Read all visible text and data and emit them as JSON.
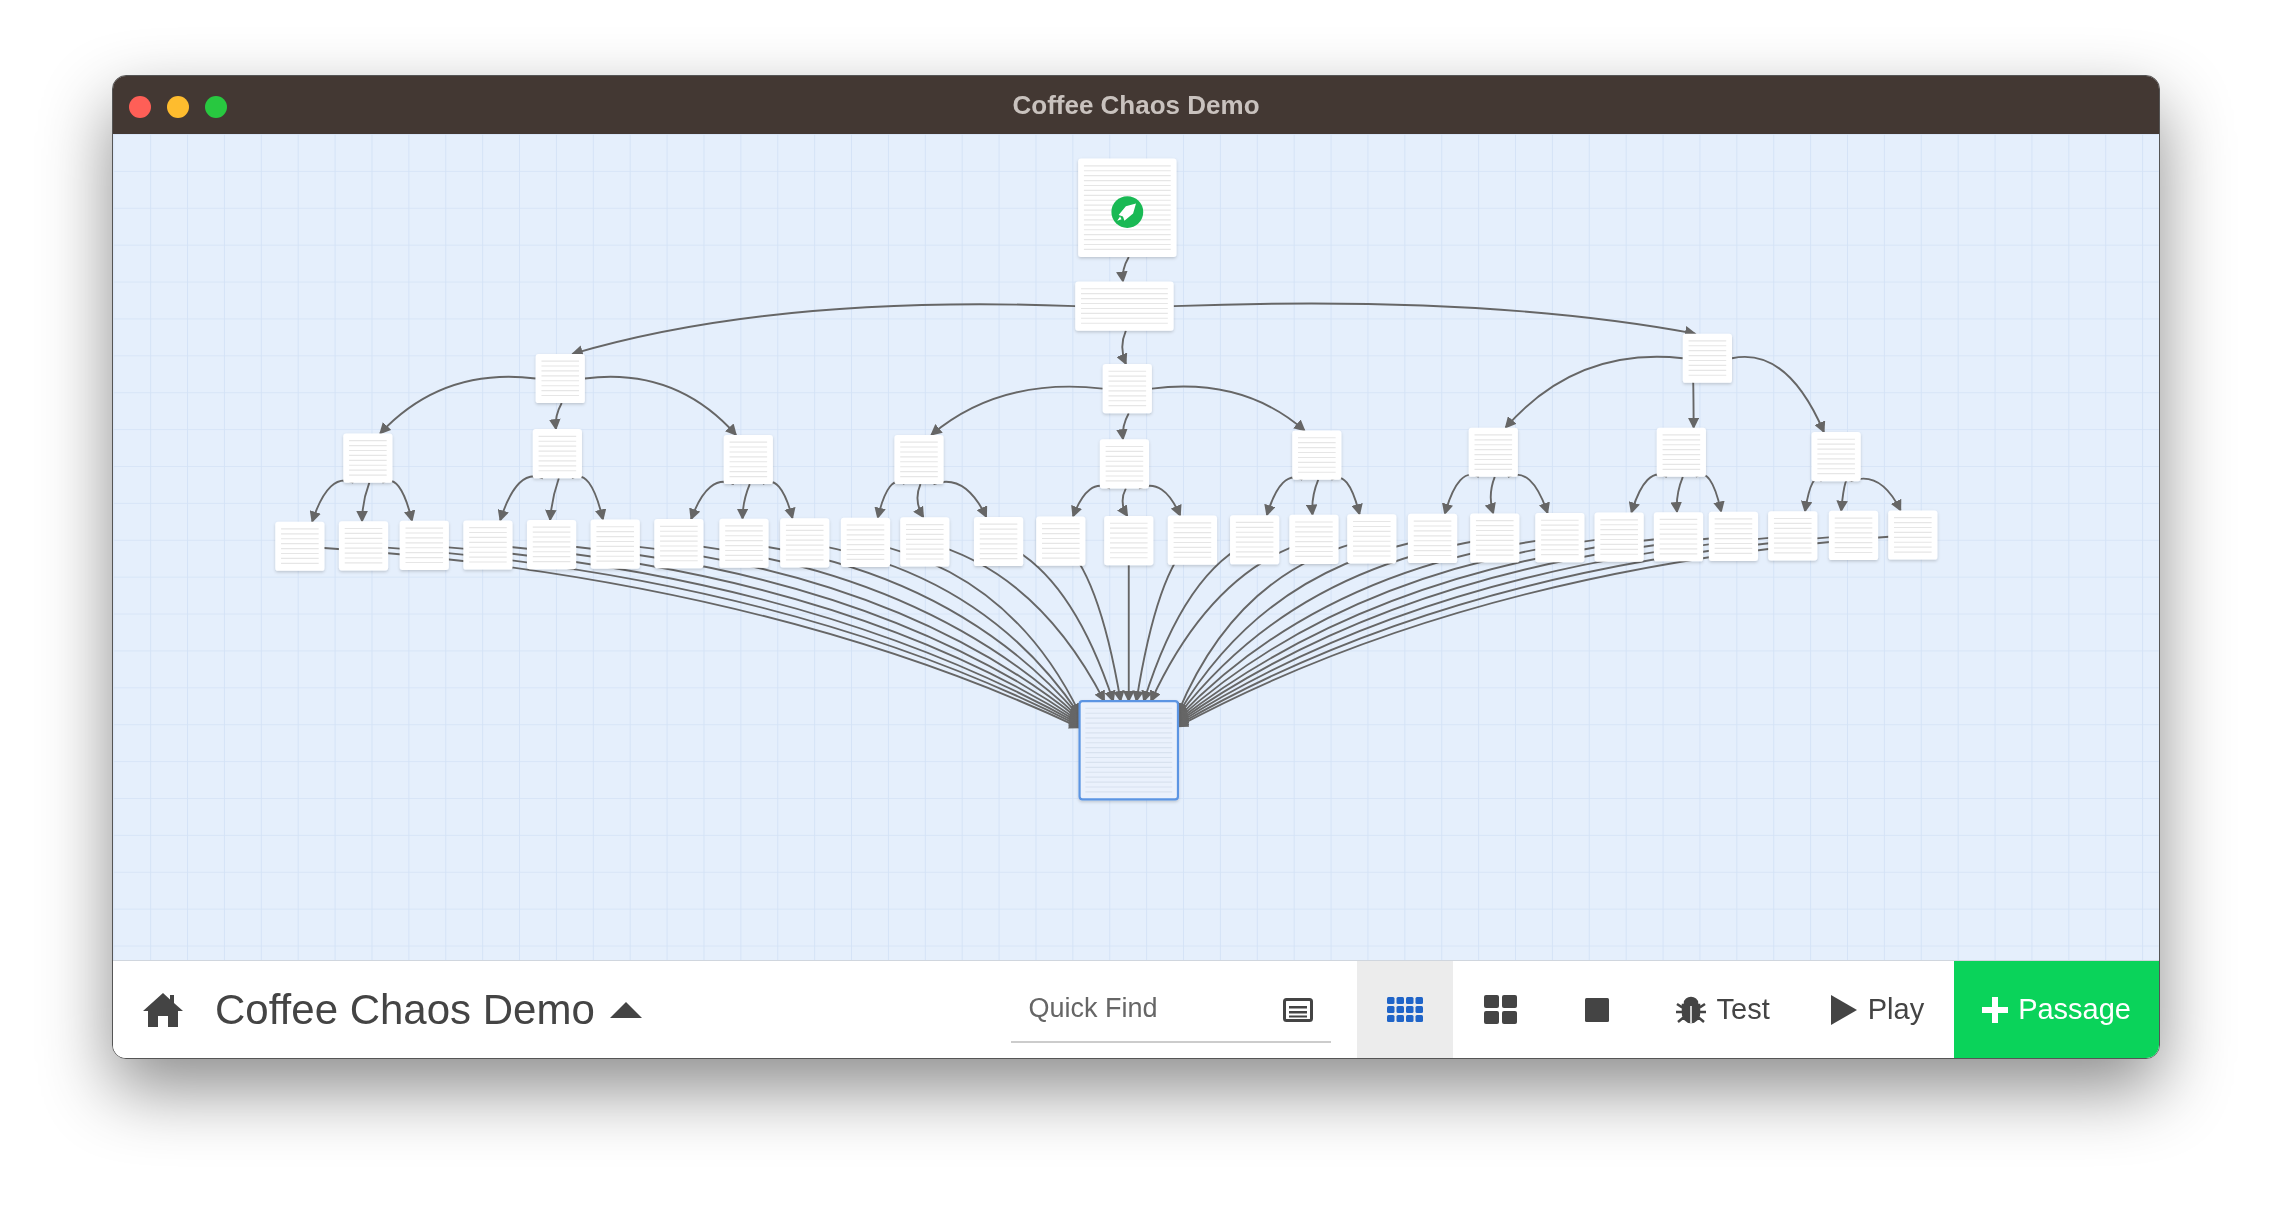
{
  "window": {
    "title": "Coffee Chaos Demo"
  },
  "story_map": {
    "passages": [
      {
        "kind": "start",
        "selected": false
      },
      {
        "kind": "wide",
        "selected": false
      },
      {
        "kind": "plain",
        "selected": false
      },
      {
        "kind": "plain",
        "selected": false
      },
      {
        "kind": "plain",
        "selected": false
      },
      {
        "kind": "plain",
        "selected": false
      },
      {
        "kind": "plain",
        "selected": false
      },
      {
        "kind": "plain",
        "selected": false
      },
      {
        "kind": "plain",
        "selected": false
      },
      {
        "kind": "plain",
        "selected": false
      },
      {
        "kind": "plain",
        "selected": false
      },
      {
        "kind": "plain",
        "selected": false
      },
      {
        "kind": "plain",
        "selected": false
      },
      {
        "kind": "plain",
        "selected": false
      },
      {
        "kind": "plain",
        "selected": false
      },
      {
        "kind": "plain",
        "selected": false
      },
      {
        "kind": "plain",
        "selected": false
      },
      {
        "kind": "plain",
        "selected": false
      },
      {
        "kind": "plain",
        "selected": false
      },
      {
        "kind": "plain",
        "selected": false
      },
      {
        "kind": "plain",
        "selected": false
      },
      {
        "kind": "plain",
        "selected": false
      },
      {
        "kind": "plain",
        "selected": false
      },
      {
        "kind": "plain",
        "selected": false
      },
      {
        "kind": "plain",
        "selected": false
      },
      {
        "kind": "plain",
        "selected": false
      },
      {
        "kind": "plain",
        "selected": false
      },
      {
        "kind": "plain",
        "selected": false
      },
      {
        "kind": "plain",
        "selected": false
      },
      {
        "kind": "plain",
        "selected": false
      },
      {
        "kind": "plain",
        "selected": false
      },
      {
        "kind": "plain",
        "selected": false
      },
      {
        "kind": "plain",
        "selected": false
      },
      {
        "kind": "plain",
        "selected": false
      },
      {
        "kind": "plain",
        "selected": false
      },
      {
        "kind": "plain",
        "selected": false
      },
      {
        "kind": "plain",
        "selected": false
      },
      {
        "kind": "plain",
        "selected": false
      },
      {
        "kind": "plain",
        "selected": false
      },
      {
        "kind": "plain",
        "selected": false
      },
      {
        "kind": "plain",
        "selected": false
      },
      {
        "kind": "big",
        "selected": true
      }
    ]
  },
  "toolbar": {
    "story_title": "Coffee Chaos Demo",
    "quick_find": {
      "placeholder": "Quick Find"
    },
    "buttons": [
      {
        "kind": "zoom-large",
        "selected": true
      },
      {
        "kind": "zoom-medium",
        "selected": false
      },
      {
        "kind": "zoom-small",
        "selected": false
      },
      {
        "kind": "test",
        "label": "Test",
        "selected": false
      },
      {
        "kind": "play",
        "label": "Play",
        "selected": false
      },
      {
        "kind": "add",
        "label": "Passage",
        "selected": false
      }
    ]
  }
}
